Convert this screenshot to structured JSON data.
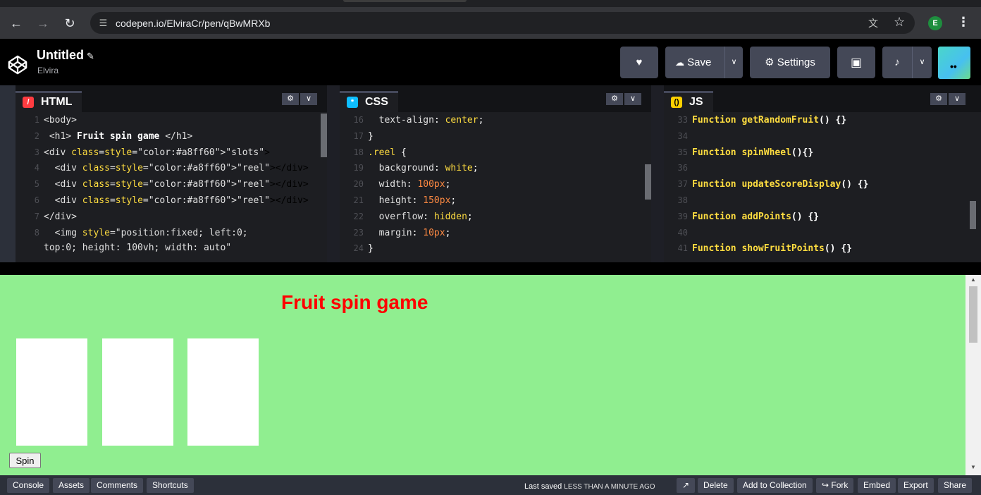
{
  "browser": {
    "url": "codepen.io/ElviraCr/pen/qBwMRXb",
    "profile_initial": "E",
    "icons": {
      "back": "arrow-left-icon",
      "forward": "arrow-right-icon",
      "reload": "reload-icon",
      "site": "tune-icon",
      "translate": "translate-icon",
      "star": "star-icon",
      "menu": "kebab-icon"
    }
  },
  "header": {
    "title": "Untitled",
    "author": "Elvira",
    "save_label": "Save",
    "settings_label": "Settings"
  },
  "editors": {
    "html": {
      "label": "HTML",
      "lines": [
        {
          "n": "1",
          "code": "<body>"
        },
        {
          "n": "2",
          "code": " <h1> Fruit spin game </h1>"
        },
        {
          "n": "3",
          "code": "<div class=\"slots\">"
        },
        {
          "n": "4",
          "code": "  <div class=\"reel\"></div>"
        },
        {
          "n": "5",
          "code": "  <div class=\"reel\"></div>"
        },
        {
          "n": "6",
          "code": "  <div class=\"reel\"></div>"
        },
        {
          "n": "7",
          "code": "</div>"
        },
        {
          "n": "8",
          "code": "  <img style=\"position:fixed; left:0;"
        },
        {
          "n": "",
          "code": "top:0; height: 100vh; width: auto\""
        }
      ]
    },
    "css": {
      "label": "CSS",
      "lines": [
        {
          "n": "16",
          "code": "  text-align: center;"
        },
        {
          "n": "17",
          "code": "}"
        },
        {
          "n": "18",
          "code": ".reel {"
        },
        {
          "n": "19",
          "code": "  background: white;"
        },
        {
          "n": "20",
          "code": "  width: 100px;"
        },
        {
          "n": "21",
          "code": "  height: 150px;"
        },
        {
          "n": "22",
          "code": "  overflow: hidden;"
        },
        {
          "n": "23",
          "code": "  margin: 10px;"
        },
        {
          "n": "24",
          "code": "}"
        }
      ]
    },
    "js": {
      "label": "JS",
      "lines": [
        {
          "n": "33",
          "code": "Function getRandomFruit() {}"
        },
        {
          "n": "34",
          "code": ""
        },
        {
          "n": "35",
          "code": "Function spinWheel(){}"
        },
        {
          "n": "36",
          "code": ""
        },
        {
          "n": "37",
          "code": "Function updateScoreDisplay() {}"
        },
        {
          "n": "38",
          "code": ""
        },
        {
          "n": "39",
          "code": "Function addPoints() {}"
        },
        {
          "n": "40",
          "code": ""
        },
        {
          "n": "41",
          "code": "Function showFruitPoints() {}"
        }
      ]
    }
  },
  "preview": {
    "heading": "Fruit spin game",
    "spin_label": "Spin",
    "background": "#90ee90",
    "heading_color": "#ff0000"
  },
  "footer": {
    "console": "Console",
    "assets": "Assets",
    "comments": "Comments",
    "shortcuts": "Shortcuts",
    "saved_prefix": "Last saved",
    "saved_time": "LESS THAN A MINUTE AGO",
    "delete": "Delete",
    "add_to_collection": "Add to Collection",
    "fork": "Fork",
    "embed": "Embed",
    "export": "Export",
    "share": "Share"
  }
}
